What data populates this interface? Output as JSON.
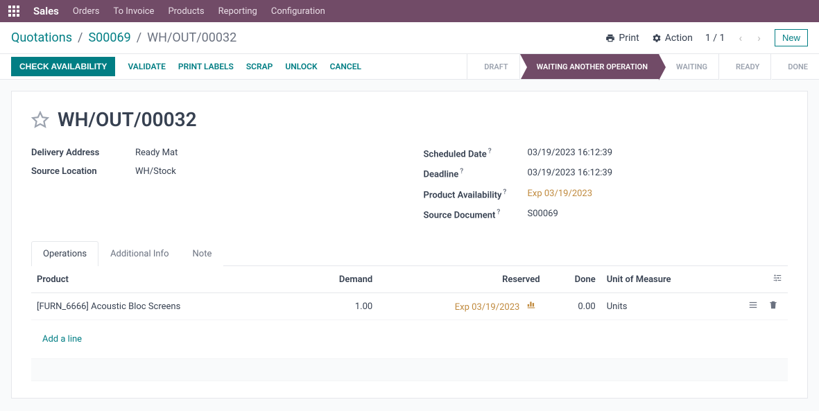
{
  "topnav": {
    "brand": "Sales",
    "items": [
      "Orders",
      "To Invoice",
      "Products",
      "Reporting",
      "Configuration"
    ]
  },
  "breadcrumb": {
    "items": [
      "Quotations",
      "S00069"
    ],
    "current": "WH/OUT/00032"
  },
  "header_actions": {
    "print": "Print",
    "action": "Action",
    "pager": "1 / 1",
    "new": "New"
  },
  "action_buttons": {
    "check_availability": "CHECK AVAILABILITY",
    "validate": "VALIDATE",
    "print_labels": "PRINT LABELS",
    "scrap": "SCRAP",
    "unlock": "UNLOCK",
    "cancel": "CANCEL"
  },
  "status_steps": {
    "draft": "DRAFT",
    "waiting_another": "WAITING ANOTHER OPERATION",
    "waiting": "WAITING",
    "ready": "READY",
    "done": "DONE"
  },
  "title": "WH/OUT/00032",
  "fields_left": {
    "delivery_address_label": "Delivery Address",
    "delivery_address_value": "Ready Mat",
    "source_location_label": "Source Location",
    "source_location_value": "WH/Stock"
  },
  "fields_right": {
    "scheduled_date_label": "Scheduled Date",
    "scheduled_date_value": "03/19/2023 16:12:39",
    "deadline_label": "Deadline",
    "deadline_value": "03/19/2023 16:12:39",
    "product_availability_label": "Product Availability",
    "product_availability_value": "Exp 03/19/2023",
    "source_document_label": "Source Document",
    "source_document_value": "S00069"
  },
  "tabs": {
    "operations": "Operations",
    "additional_info": "Additional Info",
    "note": "Note"
  },
  "table": {
    "headers": {
      "product": "Product",
      "demand": "Demand",
      "reserved": "Reserved",
      "done": "Done",
      "uom": "Unit of Measure"
    },
    "row": {
      "product": "[FURN_6666] Acoustic Bloc Screens",
      "demand": "1.00",
      "reserved": "Exp 03/19/2023",
      "done": "0.00",
      "uom": "Units"
    },
    "add_line": "Add a line"
  }
}
